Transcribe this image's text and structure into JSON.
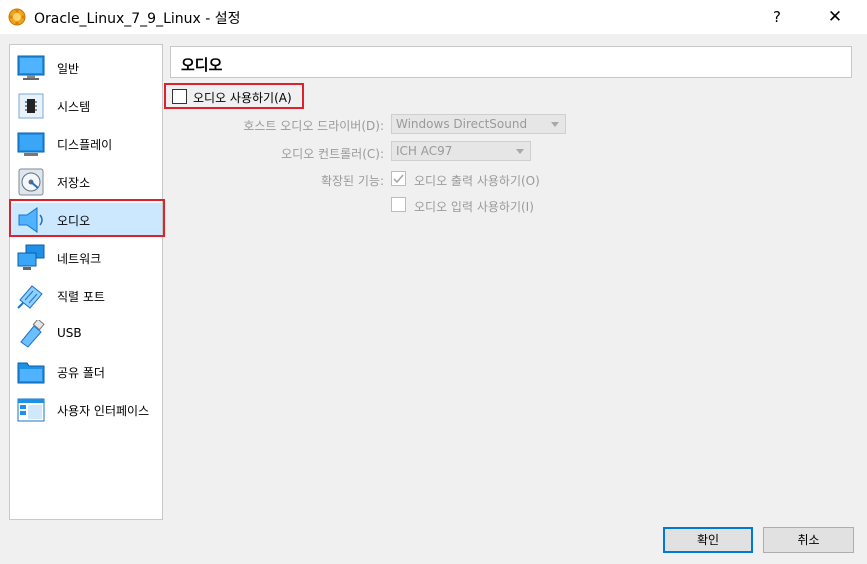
{
  "window": {
    "title": "Oracle_Linux_7_9_Linux - 설정",
    "help_label": "?",
    "close_label": "✕"
  },
  "sidebar": {
    "items": [
      {
        "label": "일반",
        "icon": "monitor-icon"
      },
      {
        "label": "시스템",
        "icon": "chip-icon"
      },
      {
        "label": "디스플레이",
        "icon": "display-icon"
      },
      {
        "label": "저장소",
        "icon": "disk-icon"
      },
      {
        "label": "오디오",
        "icon": "speaker-icon",
        "selected": true
      },
      {
        "label": "네트워크",
        "icon": "network-icon"
      },
      {
        "label": "직렬 포트",
        "icon": "serial-port-icon"
      },
      {
        "label": "USB",
        "icon": "usb-icon"
      },
      {
        "label": "공유 폴더",
        "icon": "folder-icon"
      },
      {
        "label": "사용자 인터페이스",
        "icon": "ui-window-icon"
      }
    ]
  },
  "main": {
    "section_title": "오디오",
    "enable_audio": {
      "label": "오디오 사용하기(A)",
      "checked": false
    },
    "host_driver": {
      "label": "호스트 오디오 드라이버(D):",
      "value": "Windows DirectSound"
    },
    "controller": {
      "label": "오디오 컨트롤러(C):",
      "value": "ICH AC97"
    },
    "extended": {
      "label": "확장된 기능:",
      "output": {
        "label": "오디오 출력 사용하기(O)",
        "checked": true
      },
      "input": {
        "label": "오디오 입력 사용하기(I)",
        "checked": false
      }
    }
  },
  "buttons": {
    "ok": "확인",
    "cancel": "취소"
  },
  "colors": {
    "highlight_outline": "#e0202a",
    "selected_background": "#cce8ff",
    "primary_border": "#0078d7",
    "disabled_text": "#9a9a9a"
  }
}
